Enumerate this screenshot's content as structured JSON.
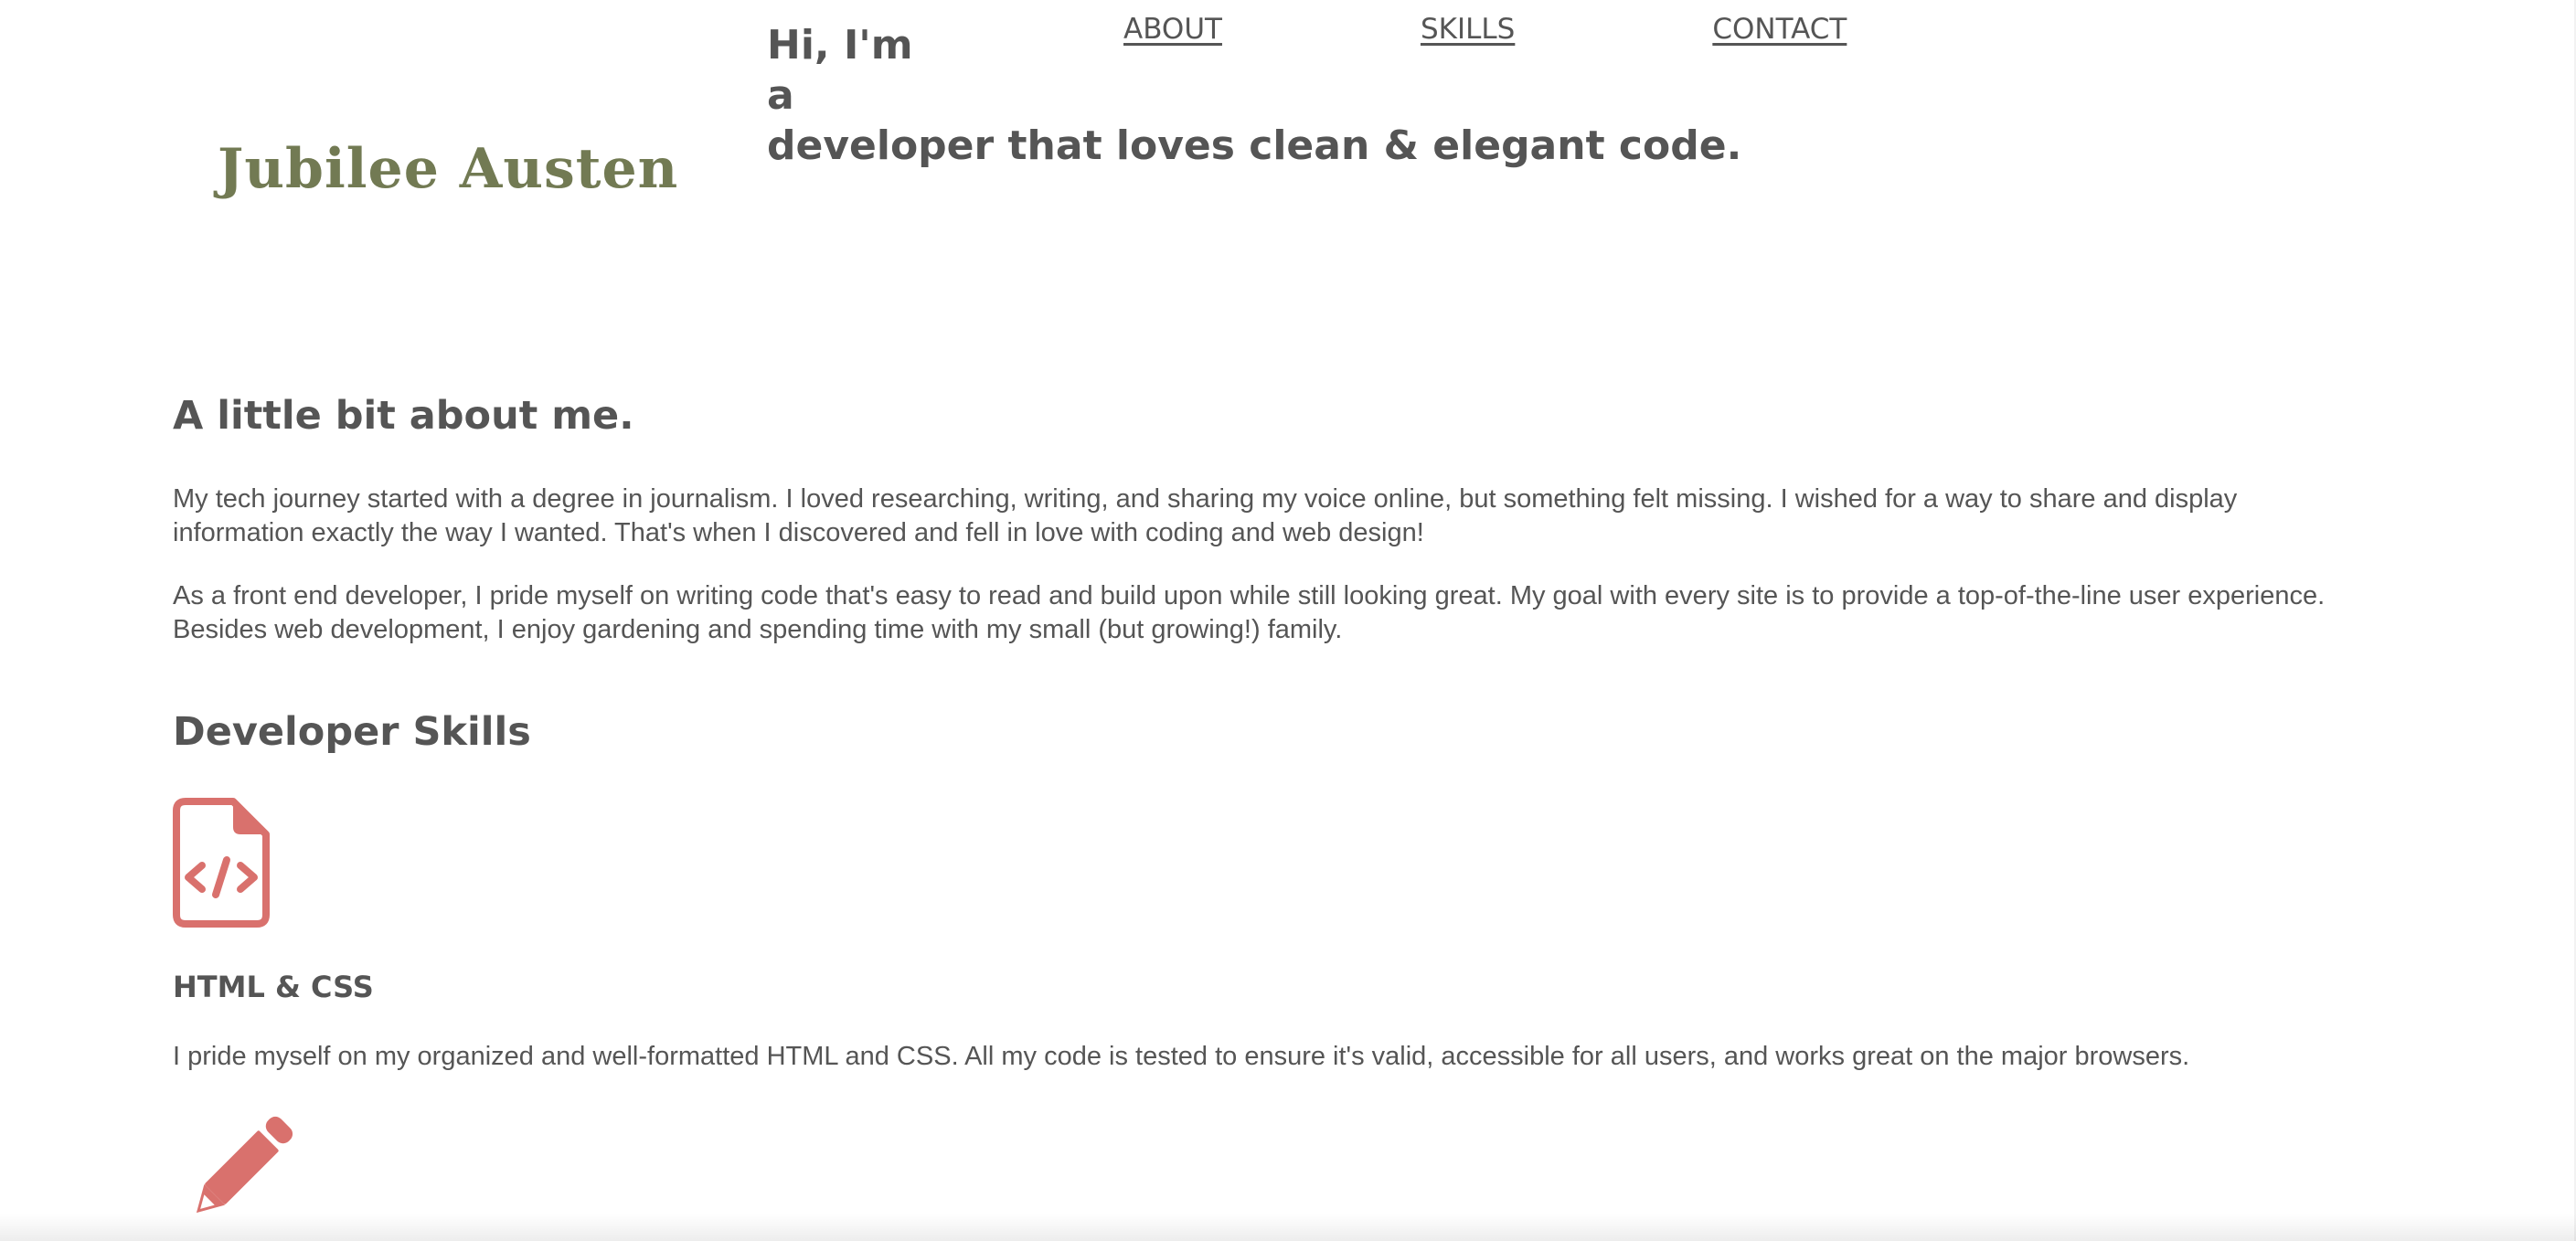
{
  "header": {
    "logo": "Jubilee Austen",
    "hero_line_1": "Hi, I'm",
    "hero_line_2": "a",
    "hero_line_3": "developer that loves clean & elegant code.",
    "nav": {
      "about": "ABOUT",
      "skills": "SKILLS",
      "contact": "CONTACT"
    }
  },
  "about": {
    "title": "A little bit about me.",
    "paragraph_1": "My tech journey started with a degree in journalism. I loved researching, writing, and sharing my voice online, but something felt missing. I wished for a way to share and display information exactly the way I wanted. That's when I discovered and fell in love with coding and web design!",
    "paragraph_2": "As a front end developer, I pride myself on writing code that's easy to read and build upon while still looking great. My goal with every site is to provide a top-of-the-line user experience. Besides web development, I enjoy gardening and spending time with my small (but growing!) family."
  },
  "skills": {
    "title": "Developer Skills",
    "items": [
      {
        "icon": "file-code-icon",
        "name": "HTML & CSS",
        "description": "I pride myself on my organized and well-formatted HTML and CSS. All my code is tested to ensure it's valid, accessible for all users, and works great on the major browsers."
      },
      {
        "icon": "pencil-icon"
      }
    ]
  },
  "colors": {
    "logo": "#727a53",
    "text": "#555555",
    "icon_accent": "#d9716d",
    "background": "#ffffff"
  }
}
